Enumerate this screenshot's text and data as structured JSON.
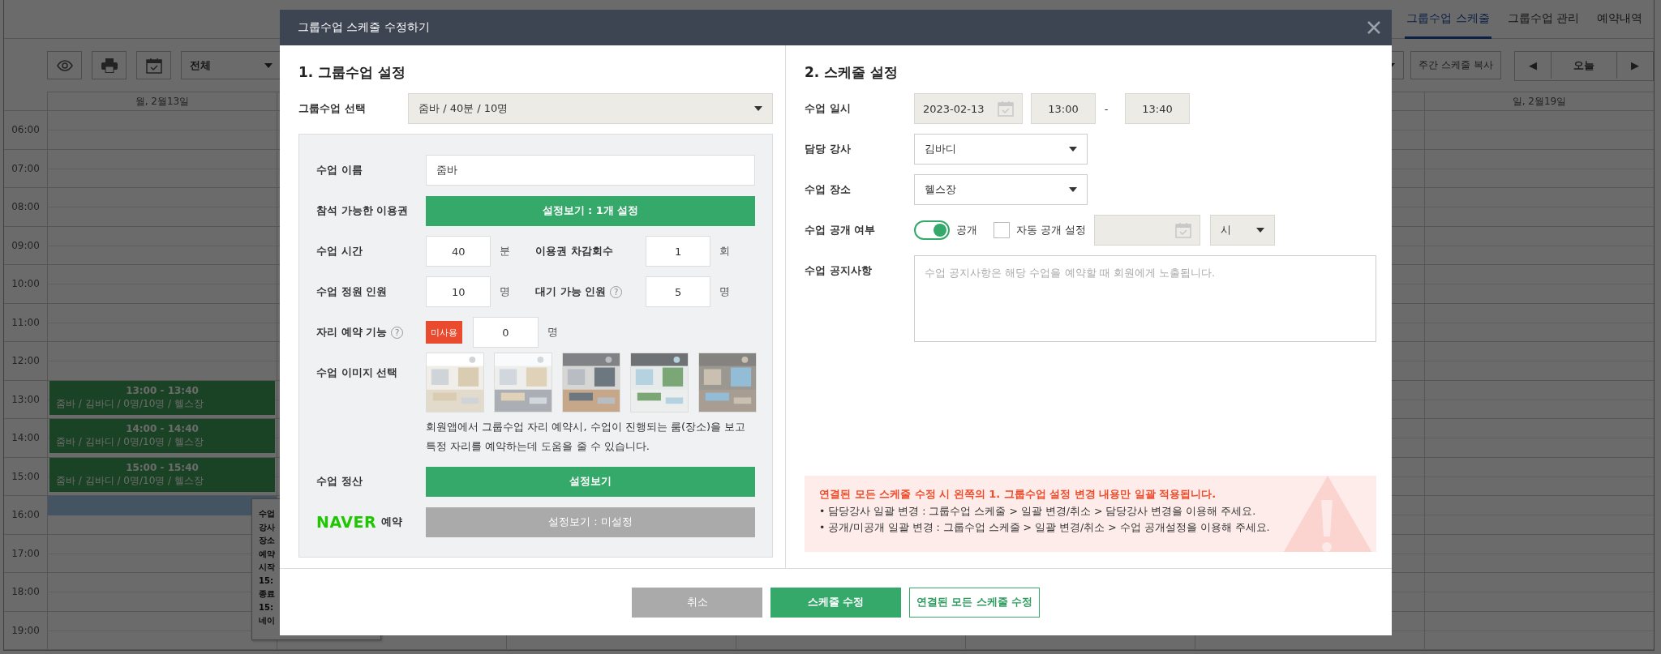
{
  "page": {
    "tabs": [
      {
        "label": "그룹수업 스케줄",
        "selected": true
      },
      {
        "label": "그룹수업 관리",
        "selected": false
      },
      {
        "label": "예약내역",
        "selected": false
      }
    ],
    "toolbar": {
      "filter": "전체",
      "copy_button": "주간 스케줄 복사",
      "prev": "◀",
      "today_button": "오늘",
      "next": "▶"
    },
    "calendar": {
      "first_day": "월, 2월13일",
      "last_day": "일, 2월19일",
      "rows": [
        {
          "time": "06:00",
          "selected": false
        },
        {
          "time": "07:00",
          "selected": false
        },
        {
          "time": "08:00",
          "selected": false
        },
        {
          "time": "09:00",
          "selected": false
        },
        {
          "time": "10:00",
          "selected": false
        },
        {
          "time": "11:00",
          "selected": false
        },
        {
          "time": "12:00",
          "selected": false
        },
        {
          "time": "13:00",
          "selected": false,
          "events": [
            {
              "time": "13:00 - 13:40",
              "detail": "줌바 / 김바디 / 0명/10명 / 헬스장"
            }
          ]
        },
        {
          "time": "14:00",
          "selected": false,
          "events": [
            {
              "time": "14:00 - 14:40",
              "detail": "줌바 / 김바디 / 0명/10명 / 헬스장"
            }
          ]
        },
        {
          "time": "15:00",
          "selected": false,
          "events": [
            {
              "time": "15:00 - 15:40",
              "detail": "줌바 / 김바디 / 0명/10명 / 헬스장"
            }
          ]
        },
        {
          "time": "16:00",
          "selected": true
        },
        {
          "time": "17:00",
          "selected": false
        },
        {
          "time": "18:00",
          "selected": false
        },
        {
          "time": "19:00",
          "selected": false
        }
      ],
      "tooltip": [
        "수업",
        "강사",
        "장소",
        "예약",
        "시작",
        "15:",
        "종료",
        "15:",
        "네이"
      ]
    }
  },
  "dialog": {
    "title": "그룹수업 스케줄 수정하기",
    "group_settings": {
      "heading": "1. 그룹수업 설정",
      "select_label": "그룹수업 선택",
      "select_value": "줌바 / 40분 / 10명",
      "class_name": {
        "label": "수업 이름",
        "value": "줌바"
      },
      "passes": {
        "label": "참석 가능한 이용권",
        "button": {
          "label": "설정보기 : 1개 설정",
          "disabled": false
        }
      },
      "duration": {
        "label": "수업 시간",
        "value": "40",
        "unit": "분"
      },
      "deduction": {
        "label": "이용권 차감회수",
        "value": "1",
        "unit": "회"
      },
      "capacity": {
        "label": "수업 정원 인원",
        "value": "10",
        "unit": "명"
      },
      "waitlist": {
        "label": "대기 가능 인원",
        "help": "?",
        "value": "5",
        "unit": "명"
      },
      "seat_booking": {
        "label": "자리 예약 기능",
        "help": "?",
        "badge": "미사용",
        "value": "0",
        "unit": "명"
      },
      "images": {
        "label": "수업 이미지 선택",
        "note": "회원앱에서 그룹수업 자리 예약시, 수업이 진행되는 룸(장소)을 보고 특정 자리를 예약하는데 도움을 줄 수 있습니다."
      },
      "settlement": {
        "label": "수업 정산",
        "button": {
          "label": "설정보기",
          "disabled": false
        }
      },
      "naver": {
        "logo": "NAVER",
        "label": "예약",
        "button": {
          "label": "설정보기 : 미설정",
          "disabled": true
        }
      }
    },
    "schedule_settings": {
      "heading": "2. 스케줄 설정",
      "datetime": {
        "label": "수업 일시",
        "date": "2023-02-13",
        "start": "13:00",
        "separator": "-",
        "end": "13:40"
      },
      "instructor": {
        "label": "담당 강사",
        "value": "김바디"
      },
      "location": {
        "label": "수업 장소",
        "value": "헬스장"
      },
      "visibility": {
        "label": "수업 공개 여부",
        "toggle": {
          "label": "공개",
          "on": true
        },
        "auto": {
          "label": "자동 공개 설정",
          "checked": false
        },
        "hour_select": "시"
      },
      "notice": {
        "label": "수업 공지사항",
        "placeholder": "수업 공지사항은 해당 수업을 예약할 때 회원에게 노출됩니다."
      },
      "warning": {
        "title": "연결된 모든 스케줄 수정 시 왼쪽의 1. 그룹수업 설정 변경 내용만 일괄 적용됩니다.",
        "items": [
          "• 담당강사 일괄 변경 : 그룹수업 스케줄 > 일괄 변경/취소 > 담당강사 변경을 이용해 주세요.",
          "• 공개/미공개 일괄 변경 : 그룹수업 스케줄 > 일괄 변경/취소 > 수업 공개설정을 이용해 주세요."
        ]
      }
    },
    "buttons": [
      {
        "label": "취소",
        "kind": "cancel"
      },
      {
        "label": "스케줄 수정",
        "kind": "primary"
      },
      {
        "label": "연결된 모든 스케줄 수정",
        "kind": "outline"
      }
    ]
  }
}
